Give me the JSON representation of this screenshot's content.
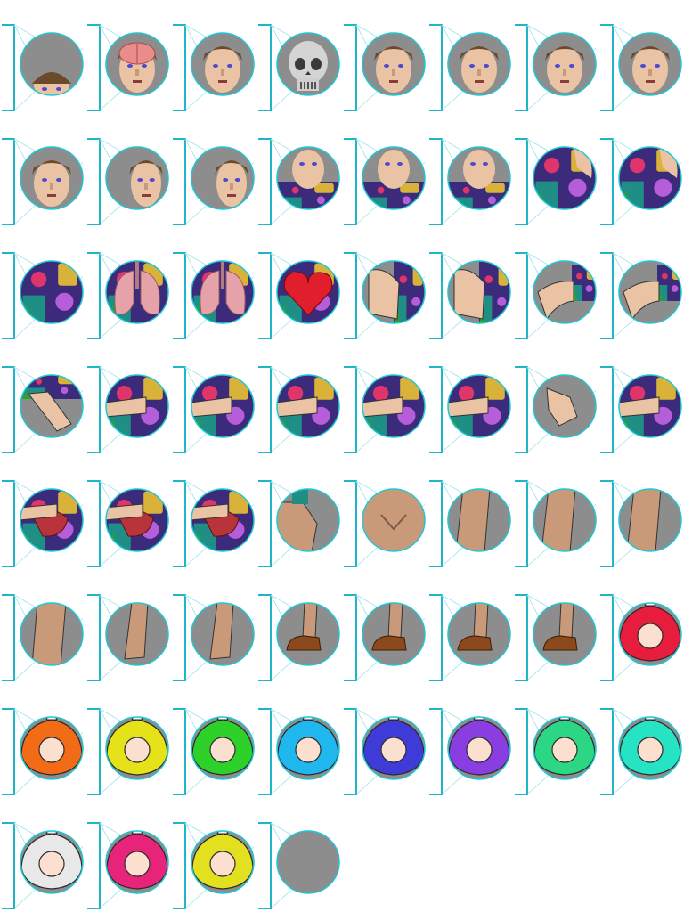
{
  "sheet": {
    "columns": 8,
    "tiles": [
      {
        "kind": "head-top",
        "icon": "head-crown-icon"
      },
      {
        "kind": "brain",
        "icon": "brain-icon"
      },
      {
        "kind": "face",
        "icon": "face-icon"
      },
      {
        "kind": "skull",
        "icon": "skull-icon"
      },
      {
        "kind": "face",
        "icon": "face-icon"
      },
      {
        "kind": "face",
        "icon": "face-icon"
      },
      {
        "kind": "face",
        "icon": "face-icon"
      },
      {
        "kind": "face",
        "icon": "face-icon"
      },
      {
        "kind": "face",
        "icon": "face-icon"
      },
      {
        "kind": "face-side",
        "icon": "face-profile-icon"
      },
      {
        "kind": "face-side",
        "icon": "face-profile-icon"
      },
      {
        "kind": "chin-shirt",
        "icon": "neck-icon"
      },
      {
        "kind": "chin-shirt",
        "icon": "neck-icon"
      },
      {
        "kind": "chin-shirt",
        "icon": "neck-icon"
      },
      {
        "kind": "shoulder",
        "icon": "shoulder-icon"
      },
      {
        "kind": "shoulder",
        "icon": "shoulder-icon"
      },
      {
        "kind": "chest",
        "icon": "chest-icon"
      },
      {
        "kind": "lungs",
        "icon": "lungs-icon"
      },
      {
        "kind": "lungs",
        "icon": "lungs-icon"
      },
      {
        "kind": "heart",
        "icon": "heart-icon"
      },
      {
        "kind": "arm",
        "icon": "upper-arm-icon"
      },
      {
        "kind": "arm",
        "icon": "upper-arm-icon"
      },
      {
        "kind": "elbow",
        "icon": "elbow-icon"
      },
      {
        "kind": "elbow",
        "icon": "elbow-icon"
      },
      {
        "kind": "forearm",
        "icon": "forearm-icon"
      },
      {
        "kind": "belly-hand",
        "icon": "hand-icon"
      },
      {
        "kind": "belly-hand",
        "icon": "hand-icon"
      },
      {
        "kind": "belly-hand",
        "icon": "hand-icon"
      },
      {
        "kind": "belly-hand",
        "icon": "hand-icon"
      },
      {
        "kind": "belly-hand",
        "icon": "hand-icon"
      },
      {
        "kind": "fist",
        "icon": "fist-icon"
      },
      {
        "kind": "belly-hand",
        "icon": "hand-icon"
      },
      {
        "kind": "stomach",
        "icon": "stomach-icon"
      },
      {
        "kind": "stomach",
        "icon": "stomach-icon"
      },
      {
        "kind": "stomach",
        "icon": "stomach-icon"
      },
      {
        "kind": "hip",
        "icon": "hip-icon"
      },
      {
        "kind": "groin",
        "icon": "groin-icon"
      },
      {
        "kind": "thigh",
        "icon": "thigh-icon"
      },
      {
        "kind": "thigh",
        "icon": "thigh-icon"
      },
      {
        "kind": "thigh",
        "icon": "thigh-icon"
      },
      {
        "kind": "knee",
        "icon": "knee-icon"
      },
      {
        "kind": "calf",
        "icon": "calf-icon"
      },
      {
        "kind": "calf",
        "icon": "calf-icon"
      },
      {
        "kind": "foot",
        "icon": "foot-icon"
      },
      {
        "kind": "foot",
        "icon": "foot-icon"
      },
      {
        "kind": "foot",
        "icon": "foot-icon"
      },
      {
        "kind": "foot",
        "icon": "foot-icon"
      },
      {
        "kind": "mask",
        "icon": "hood-red-icon",
        "color": "#e81c3c"
      },
      {
        "kind": "mask",
        "icon": "hood-orange-icon",
        "color": "#f26b16"
      },
      {
        "kind": "mask",
        "icon": "hood-yellow-icon",
        "color": "#e6e21a"
      },
      {
        "kind": "mask",
        "icon": "hood-green-icon",
        "color": "#2ed12a"
      },
      {
        "kind": "mask",
        "icon": "hood-cyan-icon",
        "color": "#1fb7ee"
      },
      {
        "kind": "mask",
        "icon": "hood-blue-icon",
        "color": "#3f3bd9"
      },
      {
        "kind": "mask",
        "icon": "hood-purple-icon",
        "color": "#8a3de0"
      },
      {
        "kind": "mask",
        "icon": "hood-mint-icon",
        "color": "#2bd684"
      },
      {
        "kind": "mask",
        "icon": "hood-teal-icon",
        "color": "#26e3c4"
      },
      {
        "kind": "mask",
        "icon": "hood-white-icon",
        "color": "#e8e8e8"
      },
      {
        "kind": "mask",
        "icon": "hood-pink-icon",
        "color": "#e8247a"
      },
      {
        "kind": "mask",
        "icon": "hood-lemon-icon",
        "color": "#e3e020"
      },
      {
        "kind": "empty",
        "icon": "empty-slot-icon"
      }
    ]
  }
}
